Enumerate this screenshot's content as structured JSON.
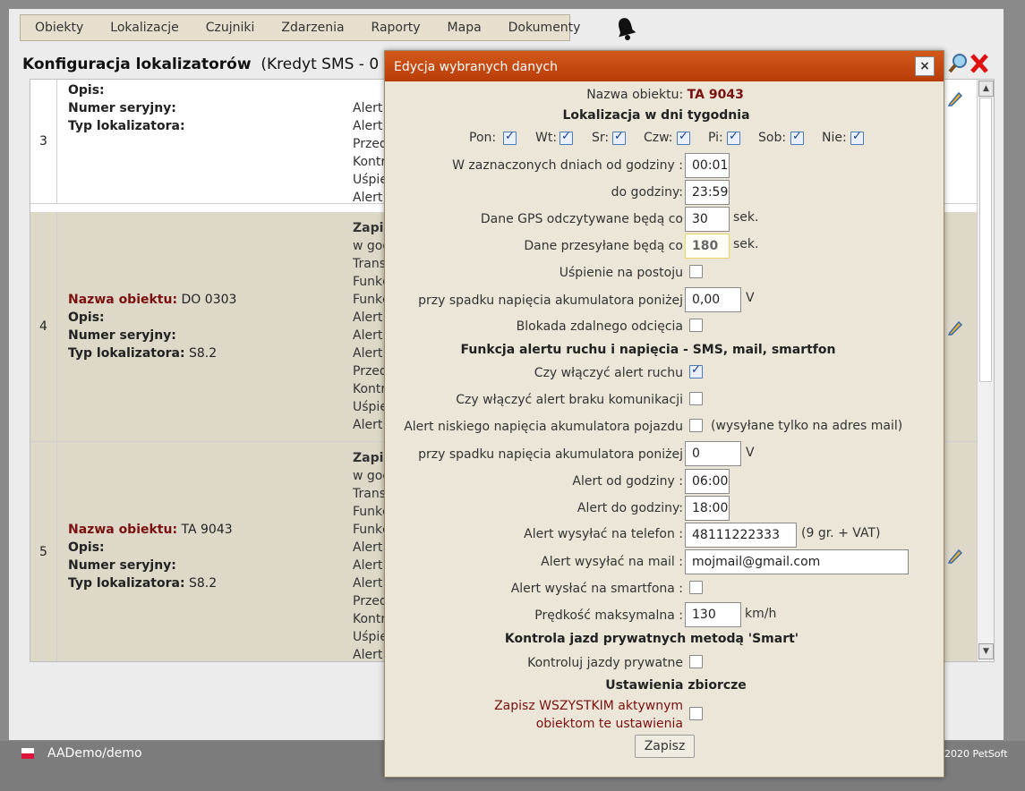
{
  "menu": {
    "items": [
      "Obiekty",
      "Lokalizacje",
      "Czujniki",
      "Zdarzenia",
      "Raporty",
      "Mapa",
      "Dokumenty"
    ]
  },
  "page": {
    "title": "Konfiguracja lokalizatorów",
    "credit": "(Kredyt SMS - 0 szt.)"
  },
  "rows": [
    {
      "num": "3",
      "lines": [
        {
          "label": "Opis:",
          "value": ""
        },
        {
          "label": "Numer seryjny:",
          "value": ""
        },
        {
          "label": "Typ lokalizatora:",
          "value": ""
        }
      ],
      "alerts": [
        "Alert",
        "Alert",
        "Przed",
        "Kontr",
        "Uśpie",
        "Alert"
      ]
    },
    {
      "num": "4",
      "lines": [
        {
          "label": "Nazwa obiektu:",
          "value": "DO 0303"
        },
        {
          "label": "Opis:",
          "value": ""
        },
        {
          "label": "Numer seryjny:",
          "value": ""
        },
        {
          "label": "Typ lokalizatora:",
          "value": "S8.2"
        }
      ],
      "alerts": [
        "Zapis",
        "w god",
        "Transı",
        "Funkc",
        "Funkc",
        "Alert",
        "Alert",
        "Alert",
        "Przed",
        "Kontr",
        "Uśpie",
        "Alert"
      ]
    },
    {
      "num": "5",
      "lines": [
        {
          "label": "Nazwa obiektu:",
          "value": "TA 9043"
        },
        {
          "label": "Opis:",
          "value": ""
        },
        {
          "label": "Numer seryjny:",
          "value": ""
        },
        {
          "label": "Typ lokalizatora:",
          "value": "S8.2"
        }
      ],
      "alerts": [
        "Zapis",
        "w god",
        "Transı",
        "Funkc",
        "Funkc",
        "Alert",
        "Alert",
        "Alert",
        "Przed",
        "Kontr",
        "Uśpie",
        "Alert"
      ]
    }
  ],
  "footer": {
    "user": "AADemo/demo",
    "copyright": "2020 PetSoft"
  },
  "dialog": {
    "title": "Edycja wybranych danych",
    "close": "×",
    "object_name_label": "Nazwa obiektu:",
    "object_name": "TA 9043",
    "days_heading": "Lokalizacja w dni tygodnia",
    "days": [
      {
        "label": "Pon:",
        "checked": true
      },
      {
        "label": "Wt:",
        "checked": true
      },
      {
        "label": "Sr:",
        "checked": true
      },
      {
        "label": "Czw:",
        "checked": true
      },
      {
        "label": "Pi:",
        "checked": true
      },
      {
        "label": "Sob:",
        "checked": true
      },
      {
        "label": "Nie:",
        "checked": true
      }
    ],
    "from_label": "W zaznaczonych dniach od godziny :",
    "from_value": "00:01",
    "to_label": "do godziny:",
    "to_value": "23:59",
    "gps_label": "Dane GPS odczytywane będą co",
    "gps_value": "30",
    "gps_unit": "sek.",
    "send_label": "Dane przesyłane będą co",
    "send_value": "180",
    "send_unit": "sek.",
    "sleep_label": "Uśpienie na postoju",
    "sleep_checked": false,
    "voltage_label": "przy spadku napięcia akumulatora poniżej",
    "voltage_value": "0,00",
    "voltage_unit": "V",
    "block_label": "Blokada zdalnego odcięcia",
    "block_checked": false,
    "alert_heading": "Funkcja alertu ruchu i napięcia - SMS, mail, smartfon",
    "motion_label": "Czy włączyć alert ruchu",
    "motion_checked": true,
    "comm_label": "Czy włączyć alert braku komunikacji",
    "comm_checked": false,
    "lowvolt_label": "Alert niskiego napięcia akumulatora pojazdu",
    "lowvolt_checked": false,
    "lowvolt_note": "(wysyłane tylko na adres mail)",
    "voltage2_label": "przy spadku napięcia akumulatora poniżej",
    "voltage2_value": "0",
    "voltage2_unit": "V",
    "alert_from_label": "Alert od godziny :",
    "alert_from_value": "06:00",
    "alert_to_label": "Alert do godziny:",
    "alert_to_value": "18:00",
    "phone_label": "Alert wysyłać na telefon :",
    "phone_value": "48111222333",
    "phone_note": "(9 gr. + VAT)",
    "mail_label": "Alert wysyłać na mail :",
    "mail_value": "mojmail@gmail.com",
    "smart_label": "Alert wysłać na smartfona :",
    "smart_checked": false,
    "speed_label": "Prędkość maksymalna :",
    "speed_value": "130",
    "speed_unit": "km/h",
    "private_heading": "Kontrola jazd prywatnych metodą 'Smart'",
    "private_label": "Kontroluj jazdy prywatne",
    "private_checked": false,
    "group_heading": "Ustawienia zbiorcze",
    "group_label_1": "Zapisz WSZYSTKIM aktywnym",
    "group_label_2": "obiektom te ustawienia",
    "group_checked": false,
    "save": "Zapisz"
  },
  "colors": {
    "accent": "#c44a10",
    "dialog_bg": "#ebe6d8",
    "row_alt": "#ddd8c8",
    "red_label": "#7a1010"
  }
}
